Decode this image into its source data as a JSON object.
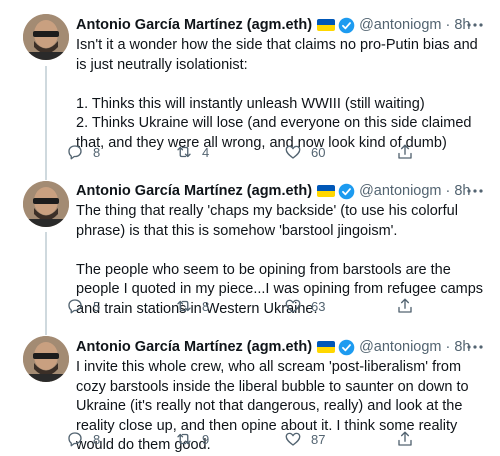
{
  "author": {
    "name": "Antonio García Martínez (agm.eth)",
    "handle": "@antoniogm",
    "separator": "·",
    "flag_colors": [
      "#0057b7",
      "#ffd700"
    ],
    "verified_color": "#1d9bf0"
  },
  "icons": {
    "more": "more-horizontal-icon",
    "reply": "reply-icon",
    "retweet": "retweet-icon",
    "like": "heart-icon",
    "share": "share-icon"
  },
  "tweets": [
    {
      "time": "8h",
      "text": [
        "Isn't it a wonder how the side that claims no pro-Putin bias and is just neutrally isolationist:",
        "",
        "1. Thinks this will instantly unleash WWIII (still waiting)",
        "2. Thinks Ukraine will lose (and everyone on this side claimed that, and they were all wrong, and now look kind of dumb)"
      ],
      "replies": "8",
      "retweets": "4",
      "likes": "60"
    },
    {
      "time": "8h",
      "text": [
        "The thing that really 'chaps my backside' (to use his colorful phrase) is that this is somehow 'barstool jingoism'.",
        "",
        "The people who seem to be opining from barstools are the people I quoted in my piece...I was opining from refugee camps and train stations in Western Ukraine."
      ],
      "replies": "5",
      "retweets": "8",
      "likes": "63"
    },
    {
      "time": "8h",
      "text": [
        "I invite this whole crew, who all scream 'post-liberalism' from cozy barstools inside the liberal bubble to saunter on down to Ukraine (it's really not that dangerous, really) and look at the reality close up, and then opine about it. I think some reality would do them good."
      ],
      "replies": "8",
      "retweets": "9",
      "likes": "87"
    }
  ]
}
